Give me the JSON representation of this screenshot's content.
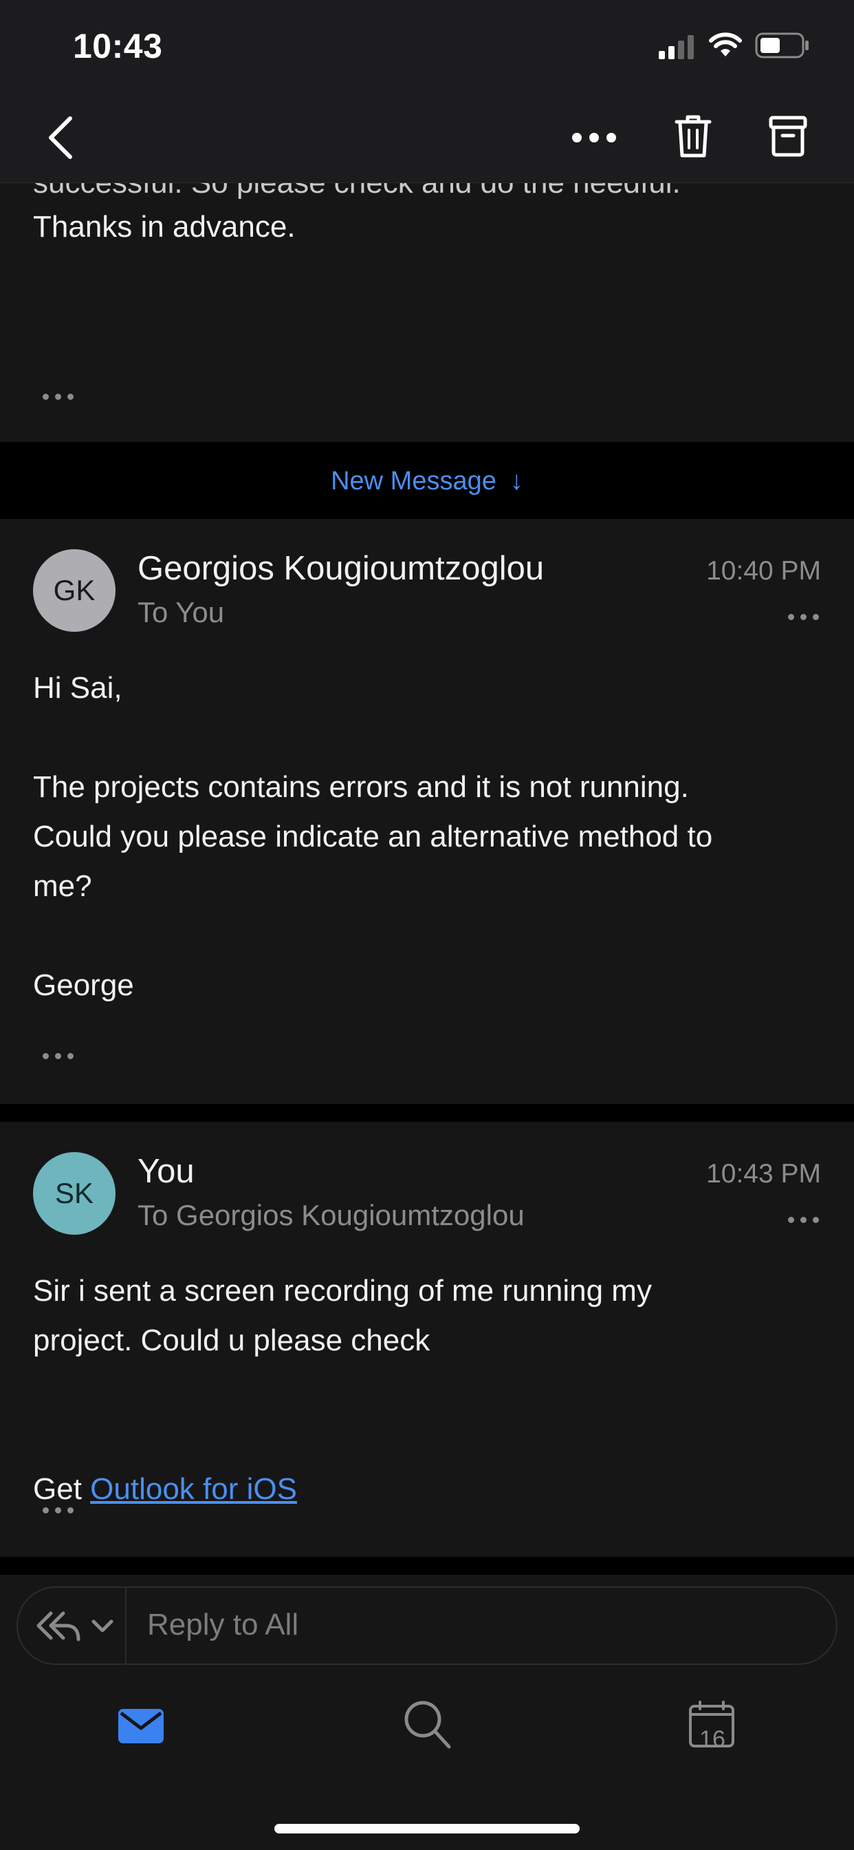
{
  "status_bar": {
    "time": "10:43"
  },
  "previous_message": {
    "partial_line": "successful. So please check and do the needful.",
    "closing": "Thanks in advance."
  },
  "new_message_banner": {
    "label": "New Message",
    "arrow": "↓"
  },
  "messages": [
    {
      "initials": "GK",
      "avatar_color": "#aeadb2",
      "sender": "Georgios Kougioumtzoglou",
      "recipient": "To You",
      "time": "10:40 PM",
      "body": "Hi Sai,\n\nThe projects contains errors and it is not running.\nCould you please indicate an alternative method to\nme?\n\nGeorge"
    },
    {
      "initials": "SK",
      "avatar_color": "#6fb5bd",
      "sender": "You",
      "recipient": "To Georgios Kougioumtzoglou",
      "time": "10:43 PM",
      "body": "Sir i sent a screen recording of me running my\nproject. Could u please check",
      "signature_prefix": "Get ",
      "signature_link": "Outlook for iOS"
    }
  ],
  "reply": {
    "placeholder": "Reply to All"
  },
  "tabbar": {
    "calendar_day": "16"
  },
  "colors": {
    "accent": "#4b8ff0",
    "background": "#000000",
    "card": "#161617"
  }
}
